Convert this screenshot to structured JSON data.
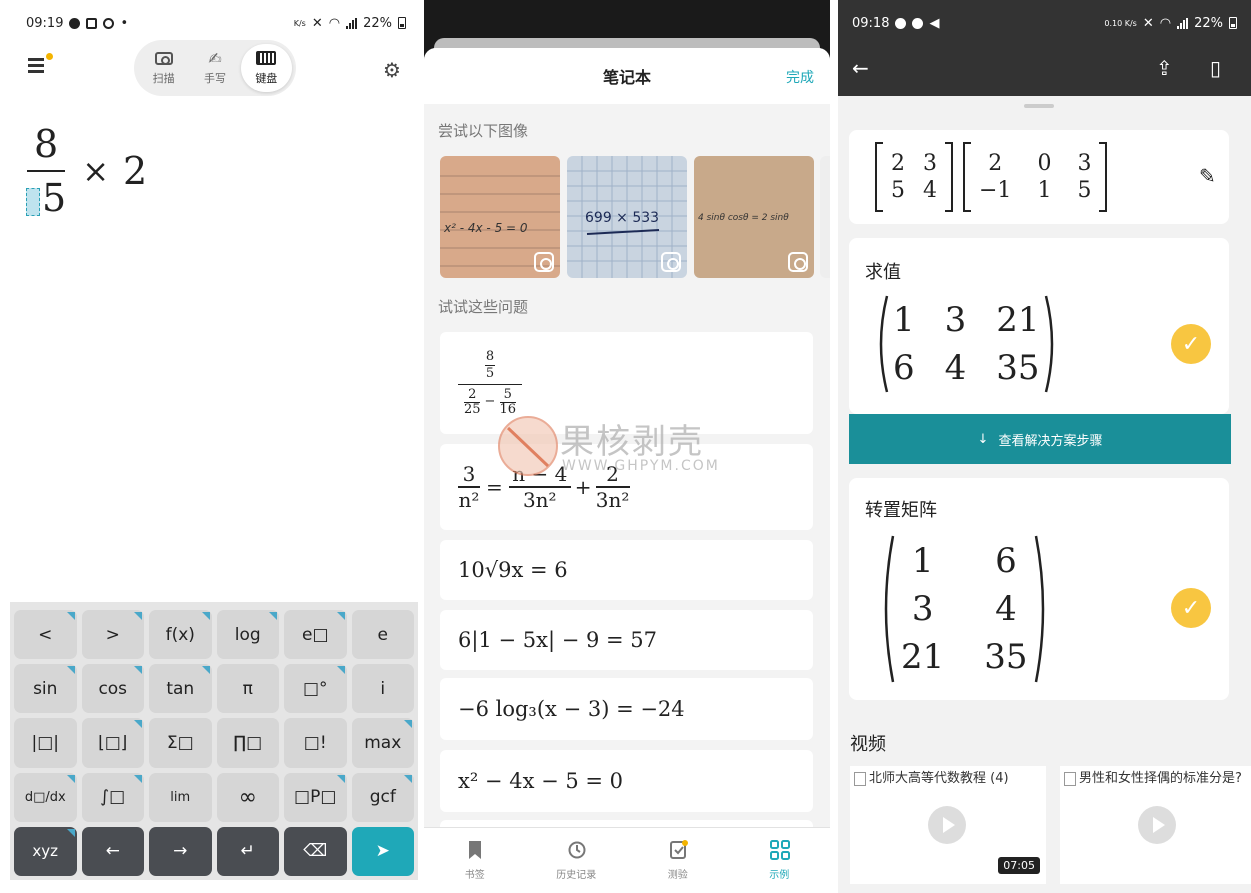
{
  "panel1": {
    "status": {
      "time": "09:19",
      "dot": "•",
      "net": "K/s",
      "battery": "22%"
    },
    "modes": [
      {
        "label": "扫描",
        "icon": "camera-icon"
      },
      {
        "label": "手写",
        "icon": "hand-write-icon"
      },
      {
        "label": "键盘",
        "icon": "keyboard-icon"
      }
    ],
    "active_mode": "键盘",
    "expression": {
      "numerator": "8",
      "denominator": "5",
      "operator": "×",
      "factor": "2"
    },
    "keypad": [
      [
        "<",
        ">",
        "f(x)",
        "log",
        "e□",
        "e"
      ],
      [
        "sin",
        "cos",
        "tan",
        "π",
        "□°",
        "i"
      ],
      [
        "|□|",
        "⌊□⌋",
        "Σ□",
        "∏□",
        "□!",
        "max"
      ],
      [
        "d□/dx",
        "∫□",
        "lim",
        "∞",
        "□P□",
        "gcf"
      ],
      [
        "xyz",
        "←",
        "→",
        "↵",
        "⌫",
        "➤"
      ]
    ]
  },
  "panel2": {
    "title": "笔记本",
    "done": "完成",
    "section_images": "尝试以下图像",
    "section_problems": "试试这些问题",
    "image_captions": [
      "x² - 4x - 5 = 0",
      "699 × 533",
      "4 sinθ cosθ = 2 sinθ"
    ],
    "problems": {
      "p1": {
        "top": "8",
        "topden": "5",
        "a_num": "2",
        "a_den": "25",
        "minus": "−",
        "b_num": "5",
        "b_den": "16"
      },
      "p2": {
        "lhs_num": "3",
        "lhs_den": "n²",
        "eq": "=",
        "m_num": "n − 4",
        "m_den": "3n²",
        "plus": "+",
        "r_num": "2",
        "r_den": "3n²"
      },
      "p3": "10√9x = 6",
      "p4": "6|1 − 5x| − 9 = 57",
      "p5": "−6 log₃(x − 3) = −24",
      "p6": "x² − 4x − 5 = 0"
    },
    "tabs": [
      {
        "label": "书签",
        "icon": "bookmark-icon"
      },
      {
        "label": "历史记录",
        "icon": "history-icon"
      },
      {
        "label": "测验",
        "icon": "quiz-icon"
      },
      {
        "label": "示例",
        "icon": "examples-grid-icon"
      }
    ],
    "active_tab": "示例"
  },
  "watermark": {
    "brand": "果核剥壳",
    "url": "WWW.GHPYM.COM"
  },
  "panel3": {
    "status": {
      "time": "09:18",
      "net": "0.10 K/s",
      "battery": "22%"
    },
    "input_matrix_a": [
      [
        "2",
        "3"
      ],
      [
        "5",
        "4"
      ]
    ],
    "input_matrix_b": [
      [
        "2",
        "0",
        "3"
      ],
      [
        "−1",
        "1",
        "5"
      ]
    ],
    "eval_label": "求值",
    "eval_result": [
      [
        "1",
        "3",
        "21"
      ],
      [
        "6",
        "4",
        "35"
      ]
    ],
    "steps_button": "查看解决方案步骤",
    "transpose_label": "转置矩阵",
    "transpose_result": [
      [
        "1",
        "6"
      ],
      [
        "3",
        "4"
      ],
      [
        "21",
        "35"
      ]
    ],
    "videos_label": "视频",
    "videos": [
      {
        "title": "北师大高等代数教程 (4)",
        "duration": "07:05"
      },
      {
        "title": "男性和女性择偶的标准分是?",
        "duration": ""
      }
    ]
  },
  "colors": {
    "accent": "#1fa8b8",
    "accent_dark": "#1a8f99",
    "check": "#f8c641",
    "keypad_bg": "#e5e5e5",
    "dark_key": "#4a4d52"
  }
}
